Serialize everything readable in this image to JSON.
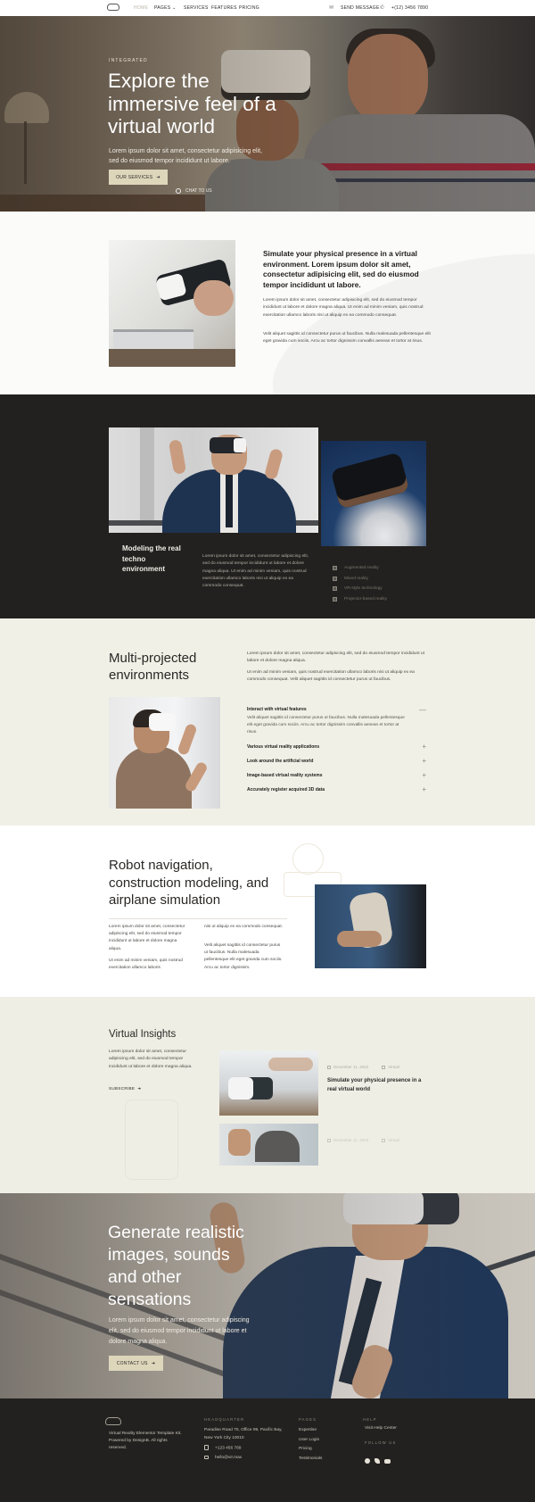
{
  "nav": {
    "items": [
      "Home",
      "Pages",
      "Services",
      "Features",
      "Pricing"
    ],
    "send_message": "Send Message",
    "phone": "+(12) 3456 7890",
    "colors": {
      "active": "#b9b4a6",
      "text": "#2a2826"
    }
  },
  "hero": {
    "eyebrow": "INTEGRATED",
    "title": "Explore the immersive feel of a virtual world",
    "lead": "Lorem ipsum dolor sit amet, consectetur adipisicing elit, sed do eiusmod tempor incididunt ut labore.",
    "primary_button": "OUR SERVICES",
    "secondary_link": "CHAT TO US"
  },
  "presence": {
    "heading": "Simulate your physical presence in a virtual environment. Lorem ipsum dolor sit amet, consectetur adipisicing elit, sed do eiusmod tempor incididunt ut labore.",
    "paragraphs": [
      "Lorem ipsum dolor sit amet, consectetur adipisicing elit, sed do eiusmod tempor incididunt ut labore et dolore magna aliqua. Ut enim ad minim veniam, quis nostrud exercitation ullamco laboris nisi ut aliquip ex ea commodo consequat.",
      "Velit aliquet sagittis id consectetur purus ut faucibus. Nulla malesuada pellentesque elit eget gravida cum sociis. Arcu ac tortor dignissim convallis aenean et tortor at risus."
    ]
  },
  "modeling": {
    "heading": "Modeling the real techno environment",
    "paragraph": "Lorem ipsum dolor sit amet, consectetur adipiscing elit, sed do eiusmod tempor incididunt ut labore et dolore magna aliqua. Ut enim ad minim veniam, quis nostrud exercitation ullamco laboris nisi ut aliquip ex ea commodo consequat.",
    "list": [
      "Augmented reality",
      "Mixed reality",
      "VR-style technology",
      "Projector-based reality"
    ]
  },
  "multi": {
    "heading": "Multi-projected environments",
    "paragraphs": [
      "Lorem ipsum dolor sit amet, consectetur adipiscing elit, sed do eiusmod tempor incididunt ut labore et dolore magna aliqua.",
      "Ut enim ad minim veniam, quis nostrud exercitation ullamco laboris nisi ut aliquip ex ea commodo consequat. Velit aliquet sagittis id consectetur purus ut faucibus."
    ],
    "accordion": [
      {
        "title": "Interact with virtual features",
        "open": true,
        "body": "Velit aliquet sagittis id consectetur purus ut faucibus. Nulla malesuada pellentesque elit eget gravida cum sociis. Arcu ac tortor dignissim convallis aenean et tortor at risus."
      },
      {
        "title": "Various virtual reality applications",
        "open": false
      },
      {
        "title": "Look around the artificial world",
        "open": false
      },
      {
        "title": "Image-based virtual reality systems",
        "open": false
      },
      {
        "title": "Accurately register acquired 3D data",
        "open": false
      }
    ],
    "open_sign": "—",
    "closed_sign": "+"
  },
  "robot": {
    "heading": "Robot navigation, construction modeling, and airplane simulation",
    "col1": [
      "Lorem ipsum dolor sit amet, consectetur adipiscing elit, sed do eiusmod tempor incididunt ut labore et dolore magna aliqua.",
      "Ut enim ad minim veniam, quis nostrud exercitation ullamco laboris"
    ],
    "col2": [
      "nisi ut aliquip ex ea commodo consequat.",
      "Velit aliquet sagittis id consectetur purus ut faucibus. Nulla malesuada pellentesque elit eget gravida cum sociis. Arcu ac tortor dignissim."
    ]
  },
  "insights": {
    "heading": "Virtual Insights",
    "paragraph": "Lorem ipsum dolor sit amet, consectetur adipiscing elit, sed do eiusmod tempor incididunt ut labore et dolore magna aliqua.",
    "subscribe": "SUBSCRIBE",
    "posts": [
      {
        "date": "December 11, 2022",
        "category": "Virtual",
        "title": "Simulate your physical presence in a real virtual world"
      },
      {
        "date": "December 11, 2022",
        "category": "Virtual",
        "title": ""
      }
    ]
  },
  "cta": {
    "title": "Generate realistic images, sounds and other sensations",
    "lead": "Lorem ipsum dolor sit amet, consectetur adipiscing elit, sed do eiusmod tempor incididunt ut labore et dolore magna aliqua.",
    "button": "CONTACT US"
  },
  "footer": {
    "about": "Virtual Reality Elementor Template Kit. Powered by DesignB. All rights reserved.",
    "hq_label": "HEADQUARTER",
    "address": "Paradise Road 70, Office 99, Pacific Bay, New York City 10010",
    "phone": "+123 456 789",
    "email": "hello@vir.max",
    "pages_label": "PAGES",
    "pages": [
      "Expertise",
      "User Login",
      "Pricing",
      "Testimonials"
    ],
    "help_label": "HELP",
    "help_link": "Visit Help Center",
    "follow_label": "FOLLOW US",
    "social": [
      "facebook",
      "twitter",
      "youtube"
    ]
  },
  "colors": {
    "dark": "#23211f",
    "cream": "#f1f0e6",
    "button": "#ddd6bb"
  }
}
